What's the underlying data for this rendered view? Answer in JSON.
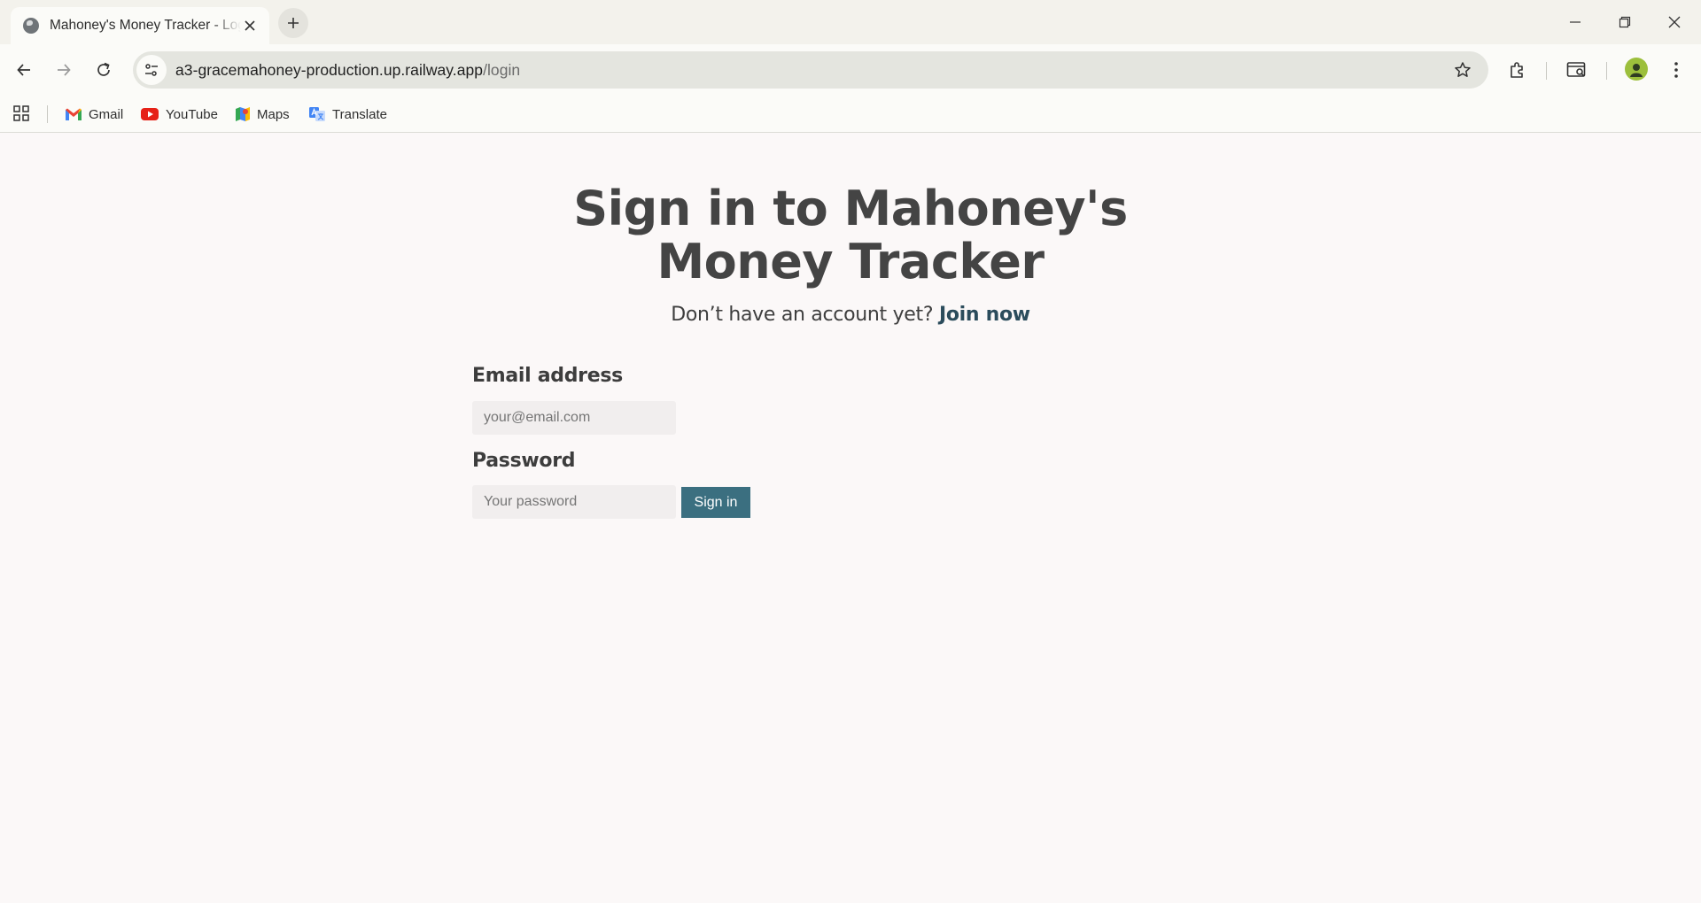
{
  "browser": {
    "tab_title": "Mahoney's Money Tracker - Login",
    "url_host": "a3-gracemahoney-production.up.railway.app",
    "url_path": "/login",
    "bookmarks": [
      {
        "label": "Gmail",
        "icon": "gmail-icon"
      },
      {
        "label": "YouTube",
        "icon": "youtube-icon"
      },
      {
        "label": "Maps",
        "icon": "maps-icon"
      },
      {
        "label": "Translate",
        "icon": "translate-icon"
      }
    ]
  },
  "page": {
    "heading": "Sign in to Mahoney's Money Tracker",
    "prompt_text": "Don’t have an account yet?",
    "join_link": "Join now",
    "email_label": "Email address",
    "email_placeholder": "your@email.com",
    "email_value": "",
    "password_label": "Password",
    "password_placeholder": "Your password",
    "password_value": "",
    "signin_label": "Sign in"
  },
  "colors": {
    "accent_button": "#3b6f80",
    "link": "#2b4c5c",
    "heading": "#444444",
    "page_bg": "#fbf8f8"
  }
}
